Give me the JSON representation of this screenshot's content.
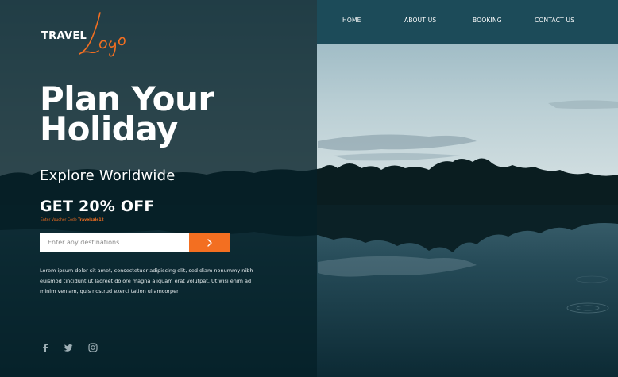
{
  "brand": {
    "logo_text": "TRAVEL",
    "logo_script": "Logo",
    "accent_color": "#f36f21",
    "panel_color": "#052028",
    "nav_color": "#1c4b59"
  },
  "nav": {
    "items": [
      {
        "label": "HOME"
      },
      {
        "label": "ABOUT US"
      },
      {
        "label": "BOOKING"
      },
      {
        "label": "CONTACT US"
      }
    ]
  },
  "hero": {
    "title_line1": "Plan Your",
    "title_line2": "Holiday",
    "subtitle": "Explore Worldwide",
    "offer": "GET 20% OFF",
    "voucher_prefix": "Enter Voucher Code",
    "voucher_code": "Travelsale12"
  },
  "search": {
    "placeholder": "Enter any destinations",
    "button_icon": "chevron-right-icon"
  },
  "body_text": "Lorem ipsum dolor sit amet, consectetuer adipiscing elit, sed diam nonummy nibh euismod tincidunt ut laoreet dolore magna aliquam erat volutpat. Ut wisi enim ad minim veniam, quis nostrud exerci tation ullamcorper",
  "social": [
    {
      "icon": "facebook-icon"
    },
    {
      "icon": "twitter-icon"
    },
    {
      "icon": "instagram-icon"
    }
  ]
}
